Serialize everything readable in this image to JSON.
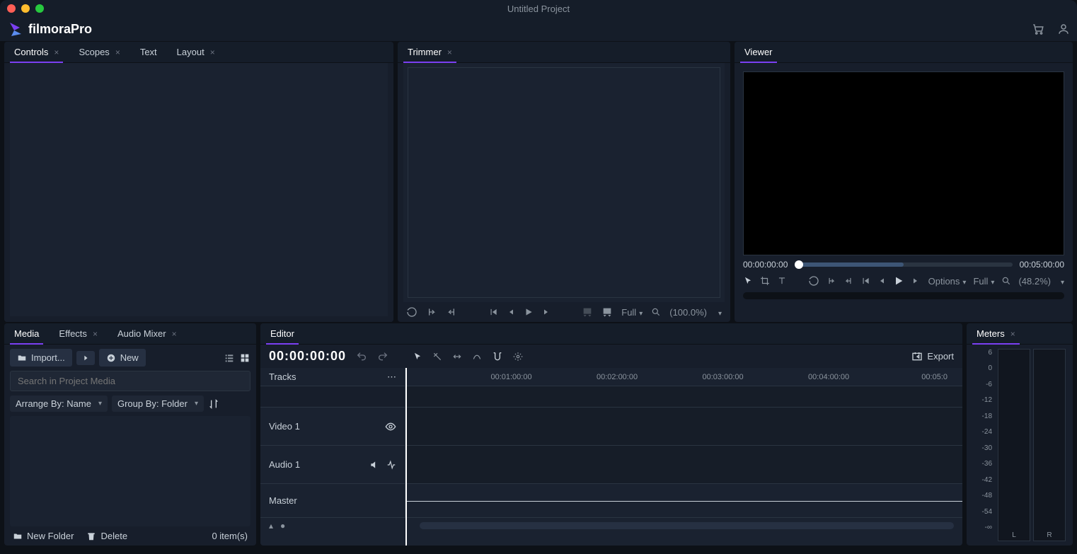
{
  "window": {
    "title": "Untitled Project"
  },
  "logo": {
    "text": "filmoraPro"
  },
  "topPanels": {
    "left": {
      "tabs": [
        {
          "label": "Controls",
          "closable": true,
          "active": true
        },
        {
          "label": "Scopes",
          "closable": true
        },
        {
          "label": "Text",
          "closable": false
        },
        {
          "label": "Layout",
          "closable": true
        }
      ]
    },
    "trimmer": {
      "tabs": [
        {
          "label": "Trimmer",
          "closable": true,
          "active": true
        }
      ],
      "toolbar": {
        "scale": "Full",
        "zoom": "(100.0%)"
      }
    },
    "viewer": {
      "tabs": [
        {
          "label": "Viewer",
          "closable": false,
          "active": true
        }
      ],
      "time_current": "00:00:00:00",
      "time_end": "00:05:00:00",
      "options_label": "Options",
      "scale": "Full",
      "zoom": "(48.2%)"
    }
  },
  "lowerPanels": {
    "media": {
      "tabs": [
        {
          "label": "Media",
          "closable": false,
          "active": true
        },
        {
          "label": "Effects",
          "closable": true
        },
        {
          "label": "Audio Mixer",
          "closable": true
        }
      ],
      "import_label": "Import...",
      "new_label": "New",
      "search_placeholder": "Search in Project Media",
      "arrange_label": "Arrange By: Name",
      "group_label": "Group By: Folder",
      "new_folder": "New Folder",
      "delete": "Delete",
      "item_count": "0 item(s)"
    },
    "editor": {
      "tabs": [
        {
          "label": "Editor",
          "closable": false,
          "active": true
        }
      ],
      "timecode": "00:00:00:00",
      "export_label": "Export",
      "tracks_label": "Tracks",
      "tracks": [
        {
          "name": "Video 1",
          "type": "video"
        },
        {
          "name": "Audio 1",
          "type": "audio"
        },
        {
          "name": "Master",
          "type": "master"
        }
      ],
      "ruler": [
        "00:01:00:00",
        "00:02:00:00",
        "00:03:00:00",
        "00:04:00:00",
        "00:05:0"
      ]
    },
    "meters": {
      "tabs": [
        {
          "label": "Meters",
          "closable": true,
          "active": true
        }
      ],
      "scale": [
        "6",
        "0",
        "-6",
        "-12",
        "-18",
        "-24",
        "-30",
        "-36",
        "-42",
        "-48",
        "-54",
        "-∞"
      ],
      "channels": [
        "L",
        "R"
      ]
    }
  }
}
